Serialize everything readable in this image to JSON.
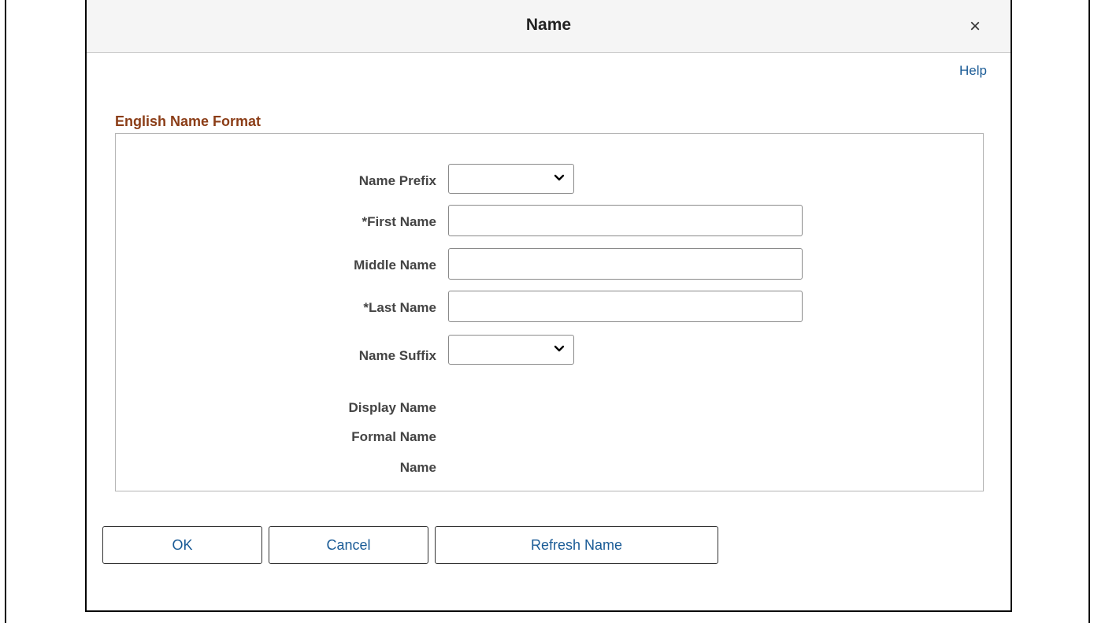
{
  "dialog": {
    "title": "Name",
    "close_label": "×",
    "help_label": "Help"
  },
  "section": {
    "title": "English Name Format"
  },
  "form": {
    "name_prefix": {
      "label": "Name Prefix",
      "value": ""
    },
    "first_name": {
      "label": "*First Name",
      "value": ""
    },
    "middle_name": {
      "label": "Middle Name",
      "value": ""
    },
    "last_name": {
      "label": "*Last Name",
      "value": ""
    },
    "name_suffix": {
      "label": "Name Suffix",
      "value": ""
    },
    "display_name": {
      "label": "Display Name",
      "value": ""
    },
    "formal_name": {
      "label": "Formal Name",
      "value": ""
    },
    "name": {
      "label": "Name",
      "value": ""
    }
  },
  "buttons": {
    "ok": "OK",
    "cancel": "Cancel",
    "refresh": "Refresh Name"
  },
  "icons": {
    "close": "close-icon",
    "dropdown": "chevron-down-icon"
  }
}
